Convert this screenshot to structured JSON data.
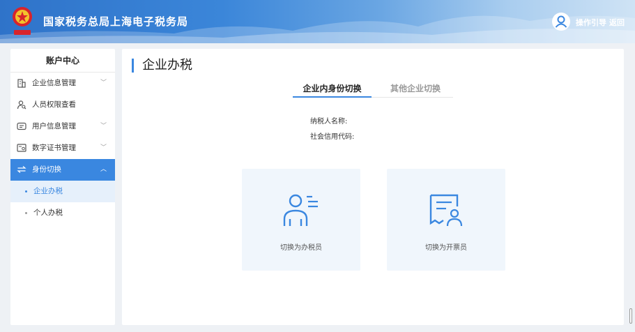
{
  "header": {
    "title": "国家税务总局上海电子税务局",
    "emblem_icon": "tax-emblem-icon",
    "user_icon": "user-avatar-icon",
    "guide_label": "操作引导",
    "back_label": "返回"
  },
  "sidebar": {
    "title": "账户中心",
    "items": [
      {
        "label": "企业信息管理",
        "icon": "building-icon",
        "chevron": "﹀"
      },
      {
        "label": "人员权限查看",
        "icon": "person-search-icon",
        "chevron": ""
      },
      {
        "label": "用户信息管理",
        "icon": "user-card-icon",
        "chevron": "﹀"
      },
      {
        "label": "数字证书管理",
        "icon": "certificate-icon",
        "chevron": "﹀"
      },
      {
        "label": "身份切换",
        "icon": "switch-icon",
        "chevron": "︿"
      }
    ],
    "sub_items": [
      {
        "label": "企业办税"
      },
      {
        "label": "个人办税"
      }
    ]
  },
  "main": {
    "title": "企业办税",
    "tabs": [
      {
        "label": "企业内身份切换"
      },
      {
        "label": "其他企业切换"
      }
    ],
    "taxpayer_name_label": "纳税人名称:",
    "credit_code_label": "社会信用代码:",
    "cards": [
      {
        "label": "切换为办税员",
        "icon": "tax-officer-icon"
      },
      {
        "label": "切换为开票员",
        "icon": "invoice-clerk-icon"
      }
    ]
  },
  "colors": {
    "accent": "#3a87e0",
    "header_start": "#2f73c9",
    "card_bg": "#f0f6fc"
  }
}
